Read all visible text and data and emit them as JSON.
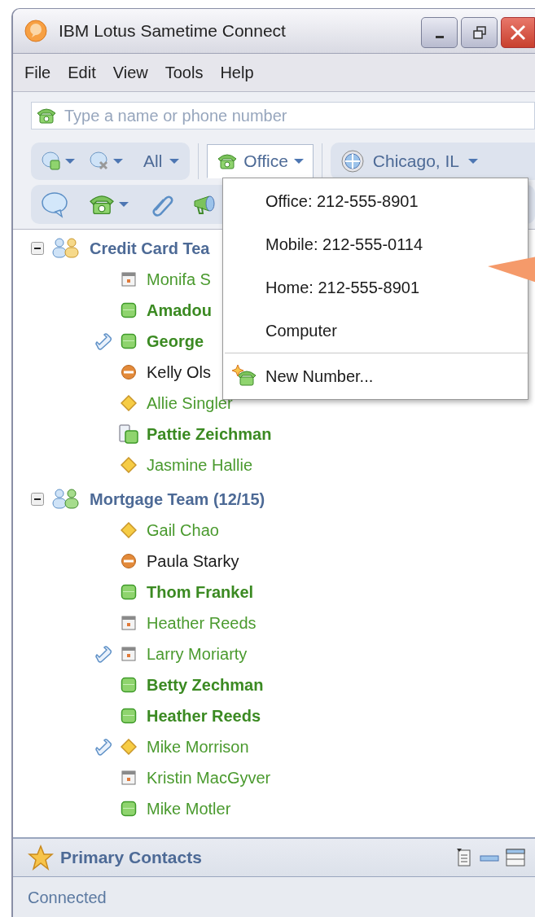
{
  "window": {
    "title": "IBM Lotus Sametime Connect"
  },
  "menu_bar": [
    "File",
    "Edit",
    "View",
    "Tools",
    "Help"
  ],
  "search": {
    "placeholder": "Type a name or phone number"
  },
  "toolbar": {
    "filter": "All",
    "phone_selector": {
      "label": "Office",
      "expanded": true
    },
    "location": "Chicago, IL"
  },
  "phone_menu": [
    {
      "label": "Office: 212-555-8901",
      "kind": "number"
    },
    {
      "label": "Mobile: 212-555-0114",
      "kind": "number"
    },
    {
      "label": "Home: 212-555-8901",
      "kind": "number"
    },
    {
      "label": "Computer",
      "kind": "number"
    },
    {
      "label": "New Number...",
      "kind": "action"
    }
  ],
  "groups": [
    {
      "name": "Credit Card Tea",
      "expanded": true,
      "contacts": [
        {
          "name": "Monifa S",
          "kind": "meeting",
          "bold": false,
          "on_phone": false
        },
        {
          "name": "Amadou",
          "kind": "available",
          "bold": true,
          "on_phone": false
        },
        {
          "name": "George",
          "kind": "available",
          "bold": true,
          "on_phone": true
        },
        {
          "name": "Kelly Ols",
          "kind": "dnd",
          "bold": false,
          "on_phone": false
        },
        {
          "name": "Allie Singler",
          "kind": "away",
          "bold": false,
          "on_phone": false
        },
        {
          "name": "Pattie Zeichman",
          "kind": "mobile",
          "bold": true,
          "on_phone": false
        },
        {
          "name": "Jasmine Hallie",
          "kind": "away",
          "bold": false,
          "on_phone": false
        }
      ]
    },
    {
      "name": "Mortgage Team (12/15)",
      "expanded": true,
      "contacts": [
        {
          "name": "Gail Chao",
          "kind": "away",
          "bold": false,
          "on_phone": false
        },
        {
          "name": "Paula Starky",
          "kind": "dnd",
          "bold": false,
          "on_phone": false
        },
        {
          "name": "Thom Frankel",
          "kind": "available",
          "bold": true,
          "on_phone": false
        },
        {
          "name": "Heather Reeds",
          "kind": "meeting",
          "bold": false,
          "on_phone": false
        },
        {
          "name": "Larry Moriarty",
          "kind": "meeting",
          "bold": false,
          "on_phone": true
        },
        {
          "name": "Betty Zechman",
          "kind": "available",
          "bold": true,
          "on_phone": false
        },
        {
          "name": "Heather Reeds",
          "kind": "available",
          "bold": true,
          "on_phone": false
        },
        {
          "name": "Mike Morrison",
          "kind": "away",
          "bold": false,
          "on_phone": true
        },
        {
          "name": "Kristin MacGyver",
          "kind": "meeting",
          "bold": false,
          "on_phone": false
        },
        {
          "name": "Mike Motler",
          "kind": "available",
          "bold": false,
          "on_phone": false
        }
      ]
    }
  ],
  "primary_contacts": {
    "title": "Primary Contacts"
  },
  "status_bar": "Connected"
}
